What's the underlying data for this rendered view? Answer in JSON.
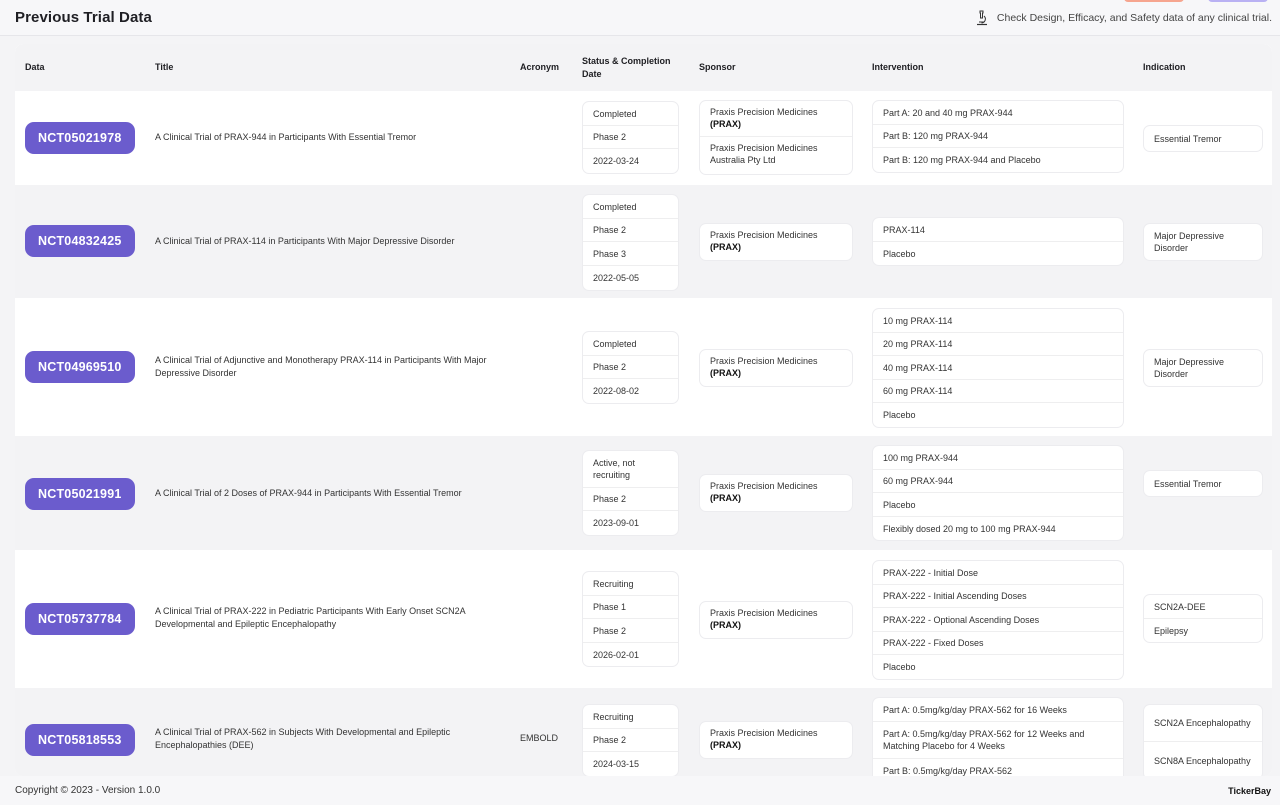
{
  "header": {
    "title": "Previous Trial Data",
    "tagline": "Check Design, Efficacy, and Safety data of any clinical trial."
  },
  "columns": {
    "data": "Data",
    "title": "Title",
    "acronym": "Acronym",
    "status": "Status & Completion Date",
    "sponsor": "Sponsor",
    "intervention": "Intervention",
    "indication": "Indication"
  },
  "trials": [
    {
      "id": "NCT05021978",
      "title": "A Clinical Trial of PRAX-944 in Participants With Essential Tremor",
      "acronym": "",
      "status": [
        "Completed",
        "Phase 2",
        "2022-03-24"
      ],
      "sponsors": [
        {
          "name": "Praxis Precision Medicines",
          "tag": "(PRAX)"
        },
        {
          "name": "Praxis Precision Medicines Australia Pty Ltd",
          "tag": ""
        }
      ],
      "interventions": [
        "Part A: 20 and 40 mg PRAX-944",
        "Part B: 120 mg PRAX-944",
        "Part B: 120 mg PRAX-944 and Placebo"
      ],
      "indications": [
        "Essential Tremor"
      ]
    },
    {
      "id": "NCT04832425",
      "title": "A Clinical Trial of PRAX-114 in Participants With Major Depressive Disorder",
      "acronym": "",
      "status": [
        "Completed",
        "Phase 2",
        "Phase 3",
        "2022-05-05"
      ],
      "sponsors": [
        {
          "name": "Praxis Precision Medicines",
          "tag": "(PRAX)"
        }
      ],
      "interventions": [
        "PRAX-114",
        "Placebo"
      ],
      "indications": [
        "Major Depressive Disorder"
      ]
    },
    {
      "id": "NCT04969510",
      "title": "A Clinical Trial of Adjunctive and Monotherapy PRAX-114 in Participants With Major Depressive Disorder",
      "acronym": "",
      "status": [
        "Completed",
        "Phase 2",
        "2022-08-02"
      ],
      "sponsors": [
        {
          "name": "Praxis Precision Medicines",
          "tag": "(PRAX)"
        }
      ],
      "interventions": [
        "10 mg PRAX-114",
        "20 mg PRAX-114",
        "40 mg PRAX-114",
        "60 mg PRAX-114",
        "Placebo"
      ],
      "indications": [
        "Major Depressive Disorder"
      ]
    },
    {
      "id": "NCT05021991",
      "title": "A Clinical Trial of 2 Doses of PRAX-944 in Participants With Essential Tremor",
      "acronym": "",
      "status": [
        "Active, not recruiting",
        "Phase 2",
        "2023-09-01"
      ],
      "sponsors": [
        {
          "name": "Praxis Precision Medicines",
          "tag": "(PRAX)"
        }
      ],
      "interventions": [
        "100 mg PRAX-944",
        "60 mg PRAX-944",
        "Placebo",
        "Flexibly dosed 20 mg to 100 mg PRAX-944"
      ],
      "indications": [
        "Essential Tremor"
      ]
    },
    {
      "id": "NCT05737784",
      "title": "A Clinical Trial of PRAX-222 in Pediatric Participants With Early Onset SCN2A Developmental and Epileptic Encephalopathy",
      "acronym": "",
      "status": [
        "Recruiting",
        "Phase 1",
        "Phase 2",
        "2026-02-01"
      ],
      "sponsors": [
        {
          "name": "Praxis Precision Medicines",
          "tag": "(PRAX)"
        }
      ],
      "interventions": [
        "PRAX-222 - Initial Dose",
        "PRAX-222 - Initial Ascending Doses",
        "PRAX-222 - Optional Ascending Doses",
        "PRAX-222 - Fixed Doses",
        "Placebo"
      ],
      "indications": [
        "SCN2A-DEE",
        "Epilepsy"
      ]
    },
    {
      "id": "NCT05818553",
      "title": "A Clinical Trial of PRAX-562 in Subjects With Developmental and Epileptic Encephalopathies (DEE)",
      "acronym": "EMBOLD",
      "status": [
        "Recruiting",
        "Phase 2",
        "2024-03-15"
      ],
      "sponsors": [
        {
          "name": "Praxis Precision Medicines",
          "tag": "(PRAX)"
        }
      ],
      "interventions": [
        "Part A: 0.5mg/kg/day PRAX-562 for 16 Weeks",
        "Part A: 0.5mg/kg/day PRAX-562 for 12 Weeks and Matching Placebo for 4 Weeks",
        "Part B: 0.5mg/kg/day PRAX-562"
      ],
      "indications": [
        "SCN2A Encephalopathy",
        "SCN8A Encephalopathy"
      ]
    }
  ],
  "footer": {
    "copyright": "Copyright © 2023 - Version 1.0.0",
    "brand": "TickerBay"
  }
}
